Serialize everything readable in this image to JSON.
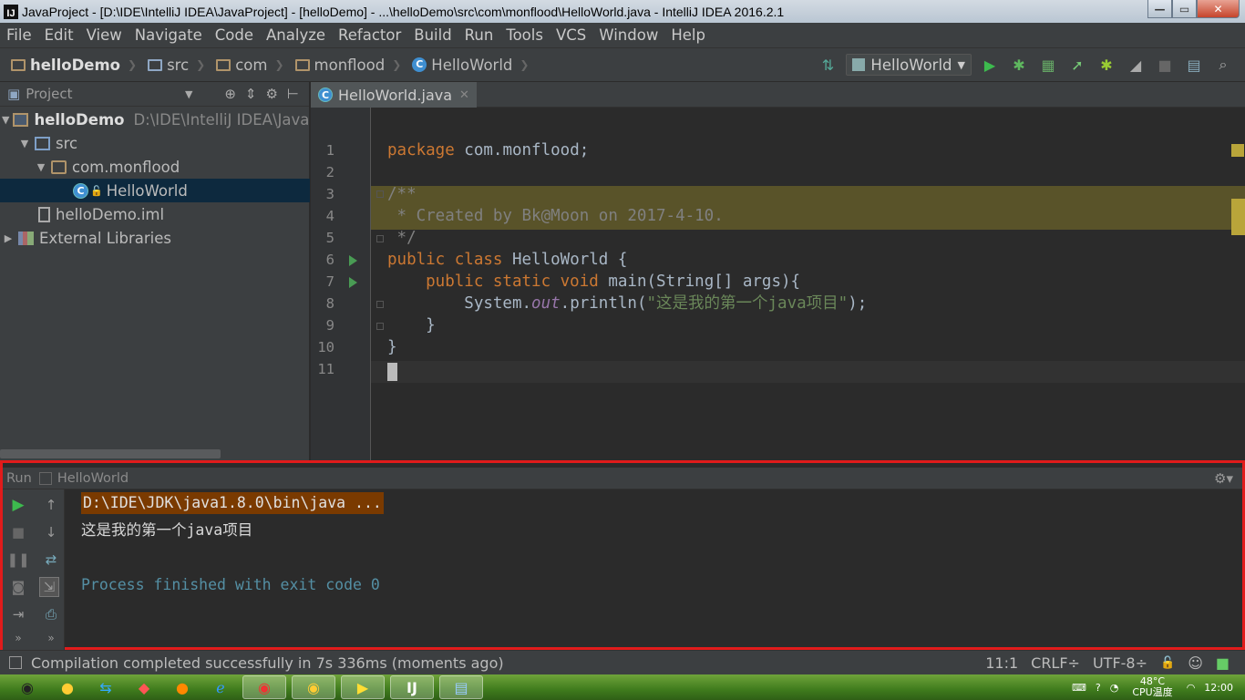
{
  "window": {
    "title": "JavaProject - [D:\\IDE\\IntelliJ IDEA\\JavaProject] - [helloDemo] - ...\\helloDemo\\src\\com\\monflood\\HelloWorld.java - IntelliJ IDEA 2016.2.1",
    "app_icon_label": "IJ"
  },
  "menu": [
    "File",
    "Edit",
    "View",
    "Navigate",
    "Code",
    "Analyze",
    "Refactor",
    "Build",
    "Run",
    "Tools",
    "VCS",
    "Window",
    "Help"
  ],
  "breadcrumbs": [
    "helloDemo",
    "src",
    "com",
    "monflood",
    "HelloWorld"
  ],
  "run_config": {
    "label": "HelloWorld"
  },
  "project_panel": {
    "title": "Project",
    "tree": [
      {
        "label": "helloDemo",
        "path": "D:\\IDE\\IntelliJ IDEA\\JavaP"
      },
      {
        "label": "src"
      },
      {
        "label": "com.monflood"
      },
      {
        "label": "HelloWorld"
      },
      {
        "label": "helloDemo.iml"
      },
      {
        "label": "External Libraries"
      }
    ]
  },
  "editor": {
    "tab_label": "HelloWorld.java",
    "line_numbers": [
      "1",
      "2",
      "3",
      "4",
      "5",
      "6",
      "7",
      "8",
      "9",
      "10",
      "11"
    ],
    "code": {
      "l1_kw": "package",
      "l1_rest": " com.monflood;",
      "l3": "/**",
      "l4": " * Created by Bk@Moon on 2017-4-10.",
      "l5": " */",
      "l6_kw": "public class",
      "l6_name": " HelloWorld",
      "l6_rest": " {",
      "l7_kw": "    public static void",
      "l7_rest": " main(String[] args){",
      "l8_a": "        System.",
      "l8_out": "out",
      "l8_b": ".println(",
      "l8_str": "\"这是我的第一个java项目\"",
      "l8_c": ");",
      "l9": "    }",
      "l10": "}"
    }
  },
  "run_panel": {
    "label": "Run",
    "config": "HelloWorld",
    "console": {
      "command": "D:\\IDE\\JDK\\java1.8.0\\bin\\java ...",
      "output": "这是我的第一个java项目",
      "exit": "Process finished with exit code 0"
    }
  },
  "status_bar": {
    "message": "Compilation completed successfully in 7s 336ms (moments ago)",
    "position": "11:1",
    "line_sep": "CRLF÷",
    "encoding": "UTF-8÷"
  },
  "taskbar": {
    "cpu_temp": "48°C",
    "cpu_label": "CPU温度",
    "clock": "12:00"
  }
}
